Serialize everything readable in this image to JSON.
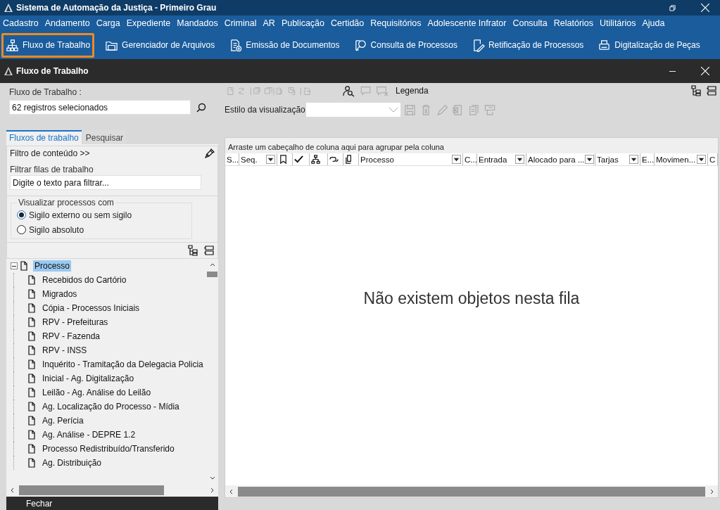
{
  "window": {
    "title": "Sistema de Automação da Justiça - Primeiro Grau"
  },
  "menu": [
    "Cadastro",
    "Andamento",
    "Carga",
    "Expediente",
    "Mandados",
    "Criminal",
    "AR",
    "Publicação",
    "Certidão",
    "Requisitórios",
    "Adolescente Infrator",
    "Consulta",
    "Relatórios",
    "Utilitários",
    "Ajuda"
  ],
  "toolbar": [
    {
      "label": "Fluxo de Trabalho",
      "selected": true
    },
    {
      "label": "Gerenciador de Arquivos",
      "selected": false
    },
    {
      "label": "Emissão de Documentos",
      "selected": false
    },
    {
      "label": "Consulta de Processos",
      "selected": false
    },
    {
      "label": "Retificação de Processos",
      "selected": false
    },
    {
      "label": "Digitalização de Peças",
      "selected": false
    }
  ],
  "subwindow": {
    "title": "Fluxo de Trabalho"
  },
  "left": {
    "workflow_label": "Fluxo de Trabalho :",
    "workflow_value": "62 registros selecionados",
    "tabs": [
      {
        "label": "Fluxos de trabalho",
        "selected": true
      },
      {
        "label": "Pesquisar",
        "selected": false
      }
    ],
    "filter_title": "Filtro de conteúdo >>",
    "filter_label": "Filtrar filas de trabalho",
    "filter_placeholder": "Digite o texto para filtrar...",
    "group_title": "Visualizar processos com",
    "radios": [
      {
        "label": "Sigilo externo ou sem sigilo",
        "selected": true
      },
      {
        "label": "Sigilo absoluto",
        "selected": false
      }
    ],
    "tree": [
      {
        "label": "Processo",
        "selected": true,
        "expanded": true,
        "children": [
          {
            "label": "Recebidos do Cartório"
          },
          {
            "label": "Migrados"
          },
          {
            "label": "Cópia - Processos Iniciais"
          },
          {
            "label": "RPV - Prefeituras"
          },
          {
            "label": "RPV - Fazenda"
          },
          {
            "label": "RPV - INSS"
          },
          {
            "label": "Inquérito - Tramitação da Delegacia Policia"
          },
          {
            "label": "Inicial - Ag. Digitalização"
          },
          {
            "label": "Leilão - Ag. Análise do Leilão"
          },
          {
            "label": "Ag. Localização do Processo - Mídia"
          },
          {
            "label": "Ag. Perícia"
          },
          {
            "label": "Ag. Análise - DEPRE 1.2"
          },
          {
            "label": "Processo Redistribuído/Transferido"
          },
          {
            "label": "Ag. Distribuição"
          }
        ]
      }
    ],
    "close_button": "Fechar"
  },
  "right": {
    "legend_button": "Legenda",
    "view_style_label": "Estilo da visualização",
    "group_hint": "Arraste um cabeçalho de coluna aqui para agrupar pela coluna",
    "columns": [
      {
        "kind": "text",
        "label": "S..."
      },
      {
        "kind": "text",
        "label": "Seq.",
        "filter": true
      },
      {
        "kind": "icon"
      },
      {
        "kind": "icon"
      },
      {
        "kind": "icon"
      },
      {
        "kind": "icon"
      },
      {
        "kind": "icon"
      },
      {
        "kind": "text",
        "label": "Processo",
        "filter": true
      },
      {
        "kind": "text",
        "label": "C..."
      },
      {
        "kind": "text",
        "label": "Entrada",
        "filter": true
      },
      {
        "kind": "text",
        "label": "Alocado para ...",
        "filter": true
      },
      {
        "kind": "text",
        "label": "Tarjas",
        "filter": true
      },
      {
        "kind": "text",
        "label": "E..."
      },
      {
        "kind": "text",
        "label": "Movimen...",
        "filter": true
      },
      {
        "kind": "text",
        "label": "C"
      }
    ],
    "empty_message": "Não existem objetos nesta fila"
  }
}
